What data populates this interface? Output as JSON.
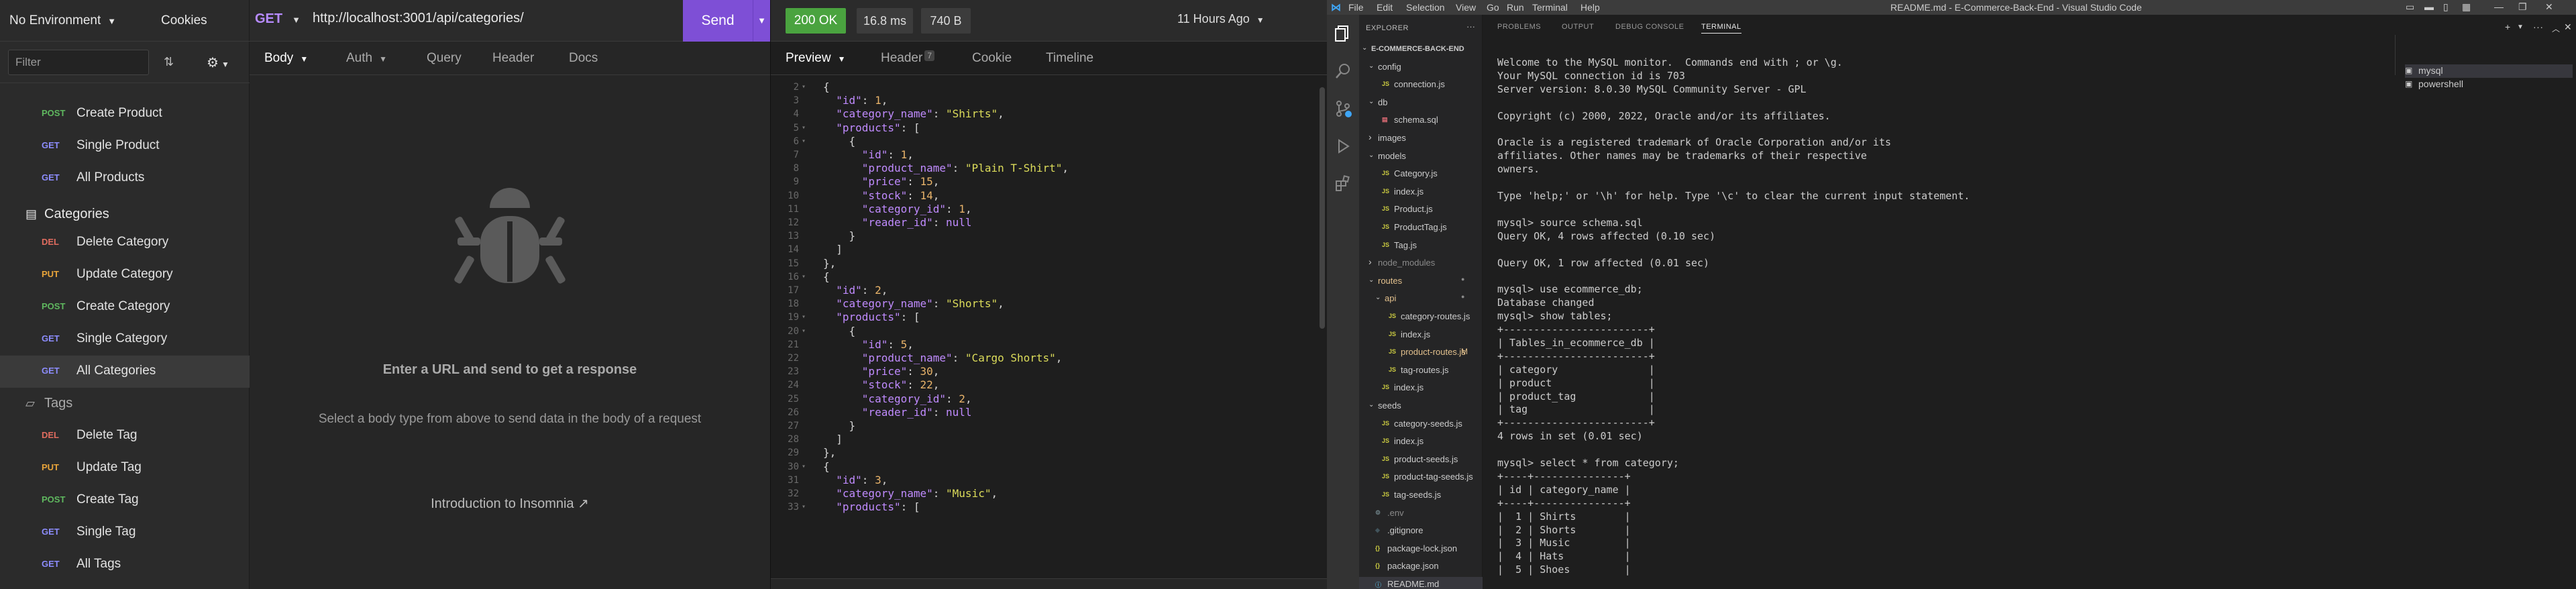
{
  "insomnia": {
    "env_label": "No Environment",
    "cookies_label": "Cookies",
    "filter_placeholder": "Filter",
    "sort_icon": "sort-icon",
    "gear_icon": "gear-icon",
    "tree": [
      {
        "kind": "req",
        "method": "POST",
        "name": "Create Product",
        "color": "#5fb85f"
      },
      {
        "kind": "req",
        "method": "GET",
        "name": "Single Product",
        "color": "#8d8dff"
      },
      {
        "kind": "req",
        "method": "GET",
        "name": "All Products",
        "color": "#8d8dff"
      },
      {
        "kind": "folder",
        "name": "Categories",
        "open": true
      },
      {
        "kind": "req",
        "method": "DEL",
        "name": "Delete Category",
        "color": "#e06c5f"
      },
      {
        "kind": "req",
        "method": "PUT",
        "name": "Update Category",
        "color": "#e8a43a"
      },
      {
        "kind": "req",
        "method": "POST",
        "name": "Create Category",
        "color": "#5fb85f"
      },
      {
        "kind": "req",
        "method": "GET",
        "name": "Single Category",
        "color": "#8d8dff"
      },
      {
        "kind": "req",
        "method": "GET",
        "name": "All Categories",
        "color": "#8d8dff",
        "active": true
      },
      {
        "kind": "folder",
        "name": "Tags",
        "open": false
      },
      {
        "kind": "req",
        "method": "DEL",
        "name": "Delete Tag",
        "color": "#e06c5f"
      },
      {
        "kind": "req",
        "method": "PUT",
        "name": "Update Tag",
        "color": "#e8a43a"
      },
      {
        "kind": "req",
        "method": "POST",
        "name": "Create Tag",
        "color": "#5fb85f"
      },
      {
        "kind": "req",
        "method": "GET",
        "name": "Single Tag",
        "color": "#8d8dff"
      },
      {
        "kind": "req",
        "method": "GET",
        "name": "All Tags",
        "color": "#8d8dff"
      }
    ],
    "request": {
      "method": "GET",
      "url": "http://localhost:3001/api/categories/",
      "send_label": "Send",
      "tabs": [
        "Body",
        "Auth",
        "Query",
        "Header",
        "Docs"
      ],
      "empty_title": "Enter a URL and send to get a response",
      "empty_sub": "Select a body type from above to send data in the body of a request",
      "empty_link": "Introduction to Insomnia"
    },
    "response": {
      "status": "200 OK",
      "time": "16.8 ms",
      "size": "740 B",
      "ago": "11 Hours Ago",
      "tabs": [
        "Preview",
        "Header",
        "Cookie",
        "Timeline"
      ],
      "header_count": "7",
      "lines": [
        {
          "n": "2",
          "fold": true,
          "t": [
            [
              "p",
              "{"
            ]
          ]
        },
        {
          "n": "3",
          "t": [
            [
              "p",
              "  "
            ],
            [
              "k",
              "\"id\""
            ],
            [
              "p",
              ": "
            ],
            [
              "nm",
              "1"
            ],
            [
              "p",
              ","
            ]
          ]
        },
        {
          "n": "4",
          "t": [
            [
              "p",
              "  "
            ],
            [
              "k",
              "\"category_name\""
            ],
            [
              "p",
              ": "
            ],
            [
              "s",
              "\"Shirts\""
            ],
            [
              "p",
              ","
            ]
          ]
        },
        {
          "n": "5",
          "fold": true,
          "t": [
            [
              "p",
              "  "
            ],
            [
              "k",
              "\"products\""
            ],
            [
              "p",
              ": ["
            ]
          ]
        },
        {
          "n": "6",
          "fold": true,
          "t": [
            [
              "p",
              "    {"
            ]
          ]
        },
        {
          "n": "7",
          "t": [
            [
              "p",
              "      "
            ],
            [
              "k",
              "\"id\""
            ],
            [
              "p",
              ": "
            ],
            [
              "nm",
              "1"
            ],
            [
              "p",
              ","
            ]
          ]
        },
        {
          "n": "8",
          "t": [
            [
              "p",
              "      "
            ],
            [
              "k",
              "\"product_name\""
            ],
            [
              "p",
              ": "
            ],
            [
              "s",
              "\"Plain T-Shirt\""
            ],
            [
              "p",
              ","
            ]
          ]
        },
        {
          "n": "9",
          "t": [
            [
              "p",
              "      "
            ],
            [
              "k",
              "\"price\""
            ],
            [
              "p",
              ": "
            ],
            [
              "nm",
              "15"
            ],
            [
              "p",
              ","
            ]
          ]
        },
        {
          "n": "10",
          "t": [
            [
              "p",
              "      "
            ],
            [
              "k",
              "\"stock\""
            ],
            [
              "p",
              ": "
            ],
            [
              "nm",
              "14"
            ],
            [
              "p",
              ","
            ]
          ]
        },
        {
          "n": "11",
          "t": [
            [
              "p",
              "      "
            ],
            [
              "k",
              "\"category_id\""
            ],
            [
              "p",
              ": "
            ],
            [
              "nm",
              "1"
            ],
            [
              "p",
              ","
            ]
          ]
        },
        {
          "n": "12",
          "t": [
            [
              "p",
              "      "
            ],
            [
              "k",
              "\"reader_id\""
            ],
            [
              "p",
              ": "
            ],
            [
              "nl",
              "null"
            ]
          ]
        },
        {
          "n": "13",
          "t": [
            [
              "p",
              "    }"
            ]
          ]
        },
        {
          "n": "14",
          "t": [
            [
              "p",
              "  ]"
            ]
          ]
        },
        {
          "n": "15",
          "t": [
            [
              "p",
              "},"
            ]
          ]
        },
        {
          "n": "16",
          "fold": true,
          "t": [
            [
              "p",
              "{"
            ]
          ]
        },
        {
          "n": "17",
          "t": [
            [
              "p",
              "  "
            ],
            [
              "k",
              "\"id\""
            ],
            [
              "p",
              ": "
            ],
            [
              "nm",
              "2"
            ],
            [
              "p",
              ","
            ]
          ]
        },
        {
          "n": "18",
          "t": [
            [
              "p",
              "  "
            ],
            [
              "k",
              "\"category_name\""
            ],
            [
              "p",
              ": "
            ],
            [
              "s",
              "\"Shorts\""
            ],
            [
              "p",
              ","
            ]
          ]
        },
        {
          "n": "19",
          "fold": true,
          "t": [
            [
              "p",
              "  "
            ],
            [
              "k",
              "\"products\""
            ],
            [
              "p",
              ": ["
            ]
          ]
        },
        {
          "n": "20",
          "fold": true,
          "t": [
            [
              "p",
              "    {"
            ]
          ]
        },
        {
          "n": "21",
          "t": [
            [
              "p",
              "      "
            ],
            [
              "k",
              "\"id\""
            ],
            [
              "p",
              ": "
            ],
            [
              "nm",
              "5"
            ],
            [
              "p",
              ","
            ]
          ]
        },
        {
          "n": "22",
          "t": [
            [
              "p",
              "      "
            ],
            [
              "k",
              "\"product_name\""
            ],
            [
              "p",
              ": "
            ],
            [
              "s",
              "\"Cargo Shorts\""
            ],
            [
              "p",
              ","
            ]
          ]
        },
        {
          "n": "23",
          "t": [
            [
              "p",
              "      "
            ],
            [
              "k",
              "\"price\""
            ],
            [
              "p",
              ": "
            ],
            [
              "nm",
              "30"
            ],
            [
              "p",
              ","
            ]
          ]
        },
        {
          "n": "24",
          "t": [
            [
              "p",
              "      "
            ],
            [
              "k",
              "\"stock\""
            ],
            [
              "p",
              ": "
            ],
            [
              "nm",
              "22"
            ],
            [
              "p",
              ","
            ]
          ]
        },
        {
          "n": "25",
          "t": [
            [
              "p",
              "      "
            ],
            [
              "k",
              "\"category_id\""
            ],
            [
              "p",
              ": "
            ],
            [
              "nm",
              "2"
            ],
            [
              "p",
              ","
            ]
          ]
        },
        {
          "n": "26",
          "t": [
            [
              "p",
              "      "
            ],
            [
              "k",
              "\"reader_id\""
            ],
            [
              "p",
              ": "
            ],
            [
              "nl",
              "null"
            ]
          ]
        },
        {
          "n": "27",
          "t": [
            [
              "p",
              "    }"
            ]
          ]
        },
        {
          "n": "28",
          "t": [
            [
              "p",
              "  ]"
            ]
          ]
        },
        {
          "n": "29",
          "t": [
            [
              "p",
              "},"
            ]
          ]
        },
        {
          "n": "30",
          "fold": true,
          "t": [
            [
              "p",
              "{"
            ]
          ]
        },
        {
          "n": "31",
          "t": [
            [
              "p",
              "  "
            ],
            [
              "k",
              "\"id\""
            ],
            [
              "p",
              ": "
            ],
            [
              "nm",
              "3"
            ],
            [
              "p",
              ","
            ]
          ]
        },
        {
          "n": "32",
          "t": [
            [
              "p",
              "  "
            ],
            [
              "k",
              "\"category_name\""
            ],
            [
              "p",
              ": "
            ],
            [
              "s",
              "\"Music\""
            ],
            [
              "p",
              ","
            ]
          ]
        },
        {
          "n": "33",
          "fold": true,
          "t": [
            [
              "p",
              "  "
            ],
            [
              "k",
              "\"products\""
            ],
            [
              "p",
              ": ["
            ]
          ]
        }
      ]
    }
  },
  "vscode": {
    "menu": [
      "File",
      "Edit",
      "Selection",
      "View",
      "Go",
      "Run",
      "Terminal",
      "Help"
    ],
    "title": "README.md - E-Commerce-Back-End - Visual Studio Code",
    "explorer_title": "EXPLORER",
    "tree": [
      {
        "d": 0,
        "type": "root",
        "name": "E-COMMERCE-BACK-END",
        "open": true
      },
      {
        "d": 1,
        "type": "folder",
        "name": "config",
        "open": true
      },
      {
        "d": 2,
        "type": "js",
        "name": "connection.js"
      },
      {
        "d": 1,
        "type": "folder",
        "name": "db",
        "open": true
      },
      {
        "d": 2,
        "type": "sql",
        "name": "schema.sql"
      },
      {
        "d": 1,
        "type": "folder",
        "name": "images",
        "open": false
      },
      {
        "d": 1,
        "type": "folder",
        "name": "models",
        "open": true
      },
      {
        "d": 2,
        "type": "js",
        "name": "Category.js"
      },
      {
        "d": 2,
        "type": "js",
        "name": "index.js"
      },
      {
        "d": 2,
        "type": "js",
        "name": "Product.js"
      },
      {
        "d": 2,
        "type": "js",
        "name": "ProductTag.js"
      },
      {
        "d": 2,
        "type": "js",
        "name": "Tag.js"
      },
      {
        "d": 1,
        "type": "folder",
        "name": "node_modules",
        "open": false,
        "dim": true
      },
      {
        "d": 1,
        "type": "folder",
        "name": "routes",
        "open": true,
        "color": "#e2c08d",
        "mark": "●"
      },
      {
        "d": 2,
        "type": "folder",
        "name": "api",
        "open": true,
        "color": "#e2c08d",
        "mark": "●"
      },
      {
        "d": 3,
        "type": "js",
        "name": "category-routes.js"
      },
      {
        "d": 3,
        "type": "js",
        "name": "index.js"
      },
      {
        "d": 3,
        "type": "js",
        "name": "product-routes.js",
        "color": "#e2c08d",
        "mark": "M"
      },
      {
        "d": 3,
        "type": "js",
        "name": "tag-routes.js"
      },
      {
        "d": 2,
        "type": "js",
        "name": "index.js"
      },
      {
        "d": 1,
        "type": "folder",
        "name": "seeds",
        "open": true
      },
      {
        "d": 2,
        "type": "js",
        "name": "category-seeds.js"
      },
      {
        "d": 2,
        "type": "js",
        "name": "index.js"
      },
      {
        "d": 2,
        "type": "js",
        "name": "product-seeds.js"
      },
      {
        "d": 2,
        "type": "js",
        "name": "product-tag-seeds.js"
      },
      {
        "d": 2,
        "type": "js",
        "name": "tag-seeds.js"
      },
      {
        "d": 1,
        "type": "env",
        "name": ".env",
        "dim": true
      },
      {
        "d": 1,
        "type": "git",
        "name": ".gitignore"
      },
      {
        "d": 1,
        "type": "json",
        "name": "package-lock.json"
      },
      {
        "d": 1,
        "type": "json",
        "name": "package.json"
      },
      {
        "d": 1,
        "type": "md",
        "name": "README.md",
        "active": true
      }
    ],
    "panel_tabs": [
      "PROBLEMS",
      "OUTPUT",
      "DEBUG CONSOLE",
      "TERMINAL"
    ],
    "terminals": [
      "mysql",
      "powershell"
    ],
    "terminal_lines": [
      "Welcome to the MySQL monitor.  Commands end with ; or \\g.",
      "Your MySQL connection id is 703",
      "Server version: 8.0.30 MySQL Community Server - GPL",
      "",
      "Copyright (c) 2000, 2022, Oracle and/or its affiliates.",
      "",
      "Oracle is a registered trademark of Oracle Corporation and/or its",
      "affiliates. Other names may be trademarks of their respective",
      "owners.",
      "",
      "Type 'help;' or '\\h' for help. Type '\\c' to clear the current input statement.",
      "",
      "mysql> source schema.sql",
      "Query OK, 4 rows affected (0.10 sec)",
      "",
      "Query OK, 1 row affected (0.01 sec)",
      "",
      "mysql> use ecommerce_db;",
      "Database changed",
      "mysql> show tables;",
      "+------------------------+",
      "| Tables_in_ecommerce_db |",
      "+------------------------+",
      "| category               |",
      "| product                |",
      "| product_tag            |",
      "| tag                    |",
      "+------------------------+",
      "4 rows in set (0.01 sec)",
      "",
      "mysql> select * from category;",
      "+----+---------------+",
      "| id | category_name |",
      "+----+---------------+",
      "|  1 | Shirts        |",
      "|  2 | Shorts        |",
      "|  3 | Music         |",
      "|  4 | Hats          |",
      "|  5 | Shoes         |"
    ]
  }
}
